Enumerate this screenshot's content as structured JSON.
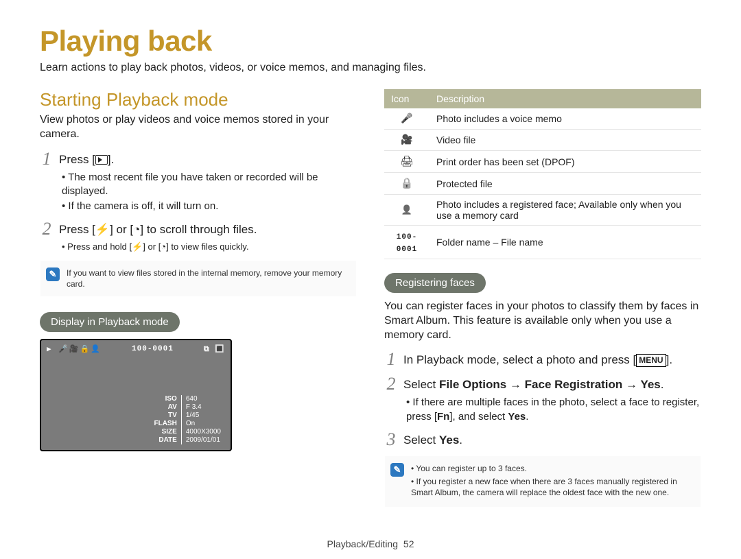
{
  "title": "Playing back",
  "intro": "Learn actions to play back photos, videos, or voice memos, and managing files.",
  "left": {
    "heading": "Starting Playback mode",
    "desc": "View photos or play videos and voice memos stored in your camera.",
    "step1_text_pre": "Press [",
    "step1_text_post": "].",
    "step1_bullets": [
      "The most recent file you have taken or recorded will be displayed.",
      "If the camera is off, it will turn on."
    ],
    "step2_text_pre": "Press [",
    "step2_text_mid": "] or [",
    "step2_text_post": "] to scroll through files.",
    "step2_bullets": [
      "Press and hold [⚡] or [◔] to view files quickly."
    ],
    "note": "If you want to view files stored in the internal memory, remove your memory card.",
    "display_pill": "Display in Playback mode",
    "lcd_top_folder": "100-0001",
    "lcd_rows": [
      [
        "ISO",
        "640"
      ],
      [
        "AV",
        "F 3.4"
      ],
      [
        "TV",
        "1/45"
      ],
      [
        "FLASH",
        "On"
      ],
      [
        "SIZE",
        "4000X3000"
      ],
      [
        "DATE",
        "2009/01/01"
      ]
    ]
  },
  "right": {
    "table_head_icon": "Icon",
    "table_head_desc": "Description",
    "rows": [
      {
        "icon": "mic",
        "text": "Photo includes a voice memo"
      },
      {
        "icon": "cam",
        "text": "Video file"
      },
      {
        "icon": "printer",
        "text": "Print order has been set (DPOF)"
      },
      {
        "icon": "lock",
        "text": "Protected file"
      },
      {
        "icon": "face",
        "text": "Photo includes a registered face; Available only when you use a memory card"
      },
      {
        "icon": "filefolder",
        "icon_text": "100-0001",
        "text": "Folder name – File name"
      }
    ],
    "faces_pill": "Registering faces",
    "faces_desc": "You can register faces in your photos to classify them by faces in Smart Album. This feature is available only when you use a memory card.",
    "step1_pre": "In Playback mode, select a photo and press [",
    "step1_menu": "MENU",
    "step1_post": "].",
    "step2_pre": "Select ",
    "step2_bold": "File Options → Face Registration → Yes",
    "step2_post": ".",
    "step2_bullets_pre": "If there are multiple faces in the photo, select a face to register, press [",
    "step2_bullets_fn": "Fn",
    "step2_bullets_mid": "], and select ",
    "step2_bullets_yes": "Yes",
    "step2_bullets_end": ".",
    "step3_pre": "Select ",
    "step3_bold": "Yes",
    "step3_post": ".",
    "note_items": [
      "You can register up to 3 faces.",
      "If you register a new face when there are 3 faces manually registered in Smart Album, the camera will replace the oldest face with the new one."
    ]
  },
  "footer_section": "Playback/Editing",
  "footer_page": "52"
}
